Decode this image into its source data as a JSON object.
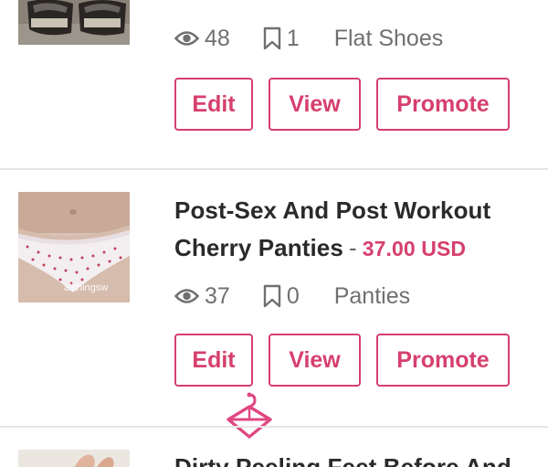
{
  "listings": [
    {
      "title": "",
      "price": "",
      "views": "48",
      "saves": "1",
      "category": "Flat Shoes",
      "image": "sandals-photo",
      "actions": {
        "edit": "Edit",
        "view": "View",
        "promote": "Promote"
      }
    },
    {
      "title": "Post-Sex And Post Workout Cherry Panties",
      "separator": "-",
      "price": "37.00 USD",
      "views": "37",
      "saves": "0",
      "category": "Panties",
      "image": "panties-photo",
      "watermark": "allthingsw",
      "actions": {
        "edit": "Edit",
        "view": "View",
        "promote": "Promote"
      }
    },
    {
      "title": "Dirty Peeling Feet Before And",
      "image": "hand-photo"
    }
  ],
  "colors": {
    "accent": "#d63f6e",
    "text": "#2a2a2a",
    "muted": "#707070",
    "divider": "#e6e6e6"
  },
  "icons": [
    "eye-icon",
    "bookmark-icon",
    "hanger-icon"
  ]
}
